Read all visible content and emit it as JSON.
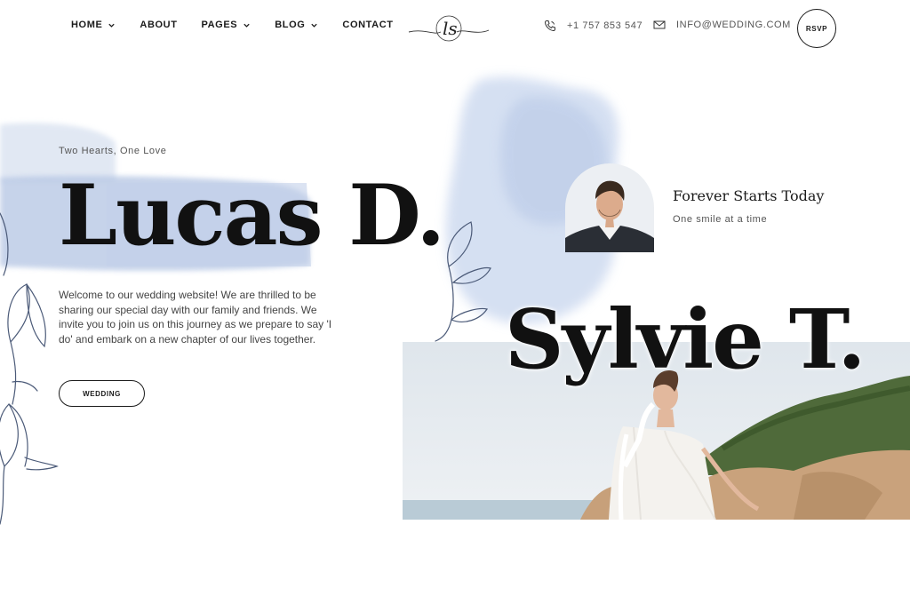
{
  "header": {
    "nav": [
      {
        "label": "HOME",
        "has_dropdown": true
      },
      {
        "label": "ABOUT",
        "has_dropdown": false
      },
      {
        "label": "PAGES",
        "has_dropdown": true
      },
      {
        "label": "BLOG",
        "has_dropdown": true
      },
      {
        "label": "CONTACT",
        "has_dropdown": false
      }
    ],
    "logo_text": "ls",
    "phone": "+1 757 853 547",
    "email": "INFO@WEDDING.COM",
    "rsvp_label": "RSVP"
  },
  "hero": {
    "tagline": "Two Hearts, One Love",
    "groom_name": "Lucas D.",
    "intro": "Welcome to our wedding website! We are thrilled to be sharing our special day with our family and friends. We invite you to join us on this journey as we prepare to say 'I do' and embark on a new chapter of our lives together.",
    "button_label": "WEDDING",
    "feature_title": "Forever Starts Today",
    "feature_subtitle": "One smile at a time",
    "bride_name": "Sylvie T."
  },
  "colors": {
    "accent_blue": "#b9c8e4",
    "text_dark": "#1a1a1a",
    "text_muted": "#555555"
  },
  "icons": [
    "chevron-down-icon",
    "phone-icon",
    "envelope-icon",
    "floral-illustration",
    "watercolor-splash"
  ]
}
